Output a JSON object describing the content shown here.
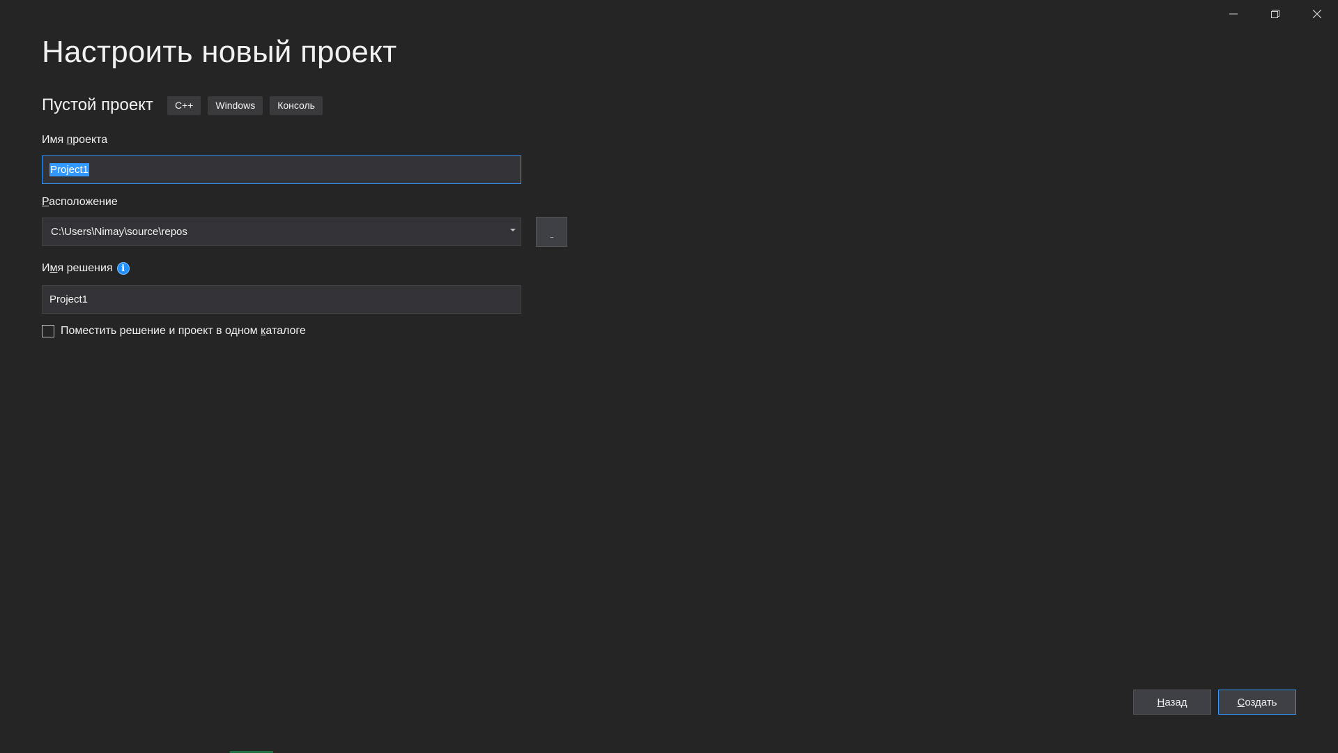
{
  "window": {
    "controls": {
      "minimize": "minimize-icon",
      "restore": "restore-icon",
      "close": "close-icon"
    }
  },
  "header": {
    "title": "Настроить новый проект"
  },
  "template": {
    "name": "Пустой проект",
    "tags": [
      "C++",
      "Windows",
      "Консоль"
    ]
  },
  "form": {
    "project_name": {
      "label_prefix": "Имя ",
      "label_mnemonic": "п",
      "label_suffix": "роекта",
      "value": "Project1"
    },
    "location": {
      "label_mnemonic": "Р",
      "label_suffix": "асположение",
      "value": "C:\\Users\\Nimay\\source\\repos",
      "browse_label": "..."
    },
    "solution_name": {
      "label_prefix": "И",
      "label_mnemonic": "м",
      "label_suffix": "я решения",
      "info_icon": "info-icon",
      "info_glyph": "i",
      "value": "Project1"
    },
    "same_dir": {
      "checked": false,
      "label_prefix": "Поместить решение и проект в одном ",
      "label_mnemonic": "к",
      "label_suffix": "аталоге"
    }
  },
  "footer": {
    "back": {
      "mnemonic": "Н",
      "rest": "азад"
    },
    "create": {
      "mnemonic": "С",
      "rest": "оздать"
    }
  },
  "colors": {
    "background": "#252526",
    "input_bg": "#333337",
    "focus_accent": "#3399ff",
    "info_blue": "#1e90ff",
    "button_bg": "#3f3f46"
  }
}
